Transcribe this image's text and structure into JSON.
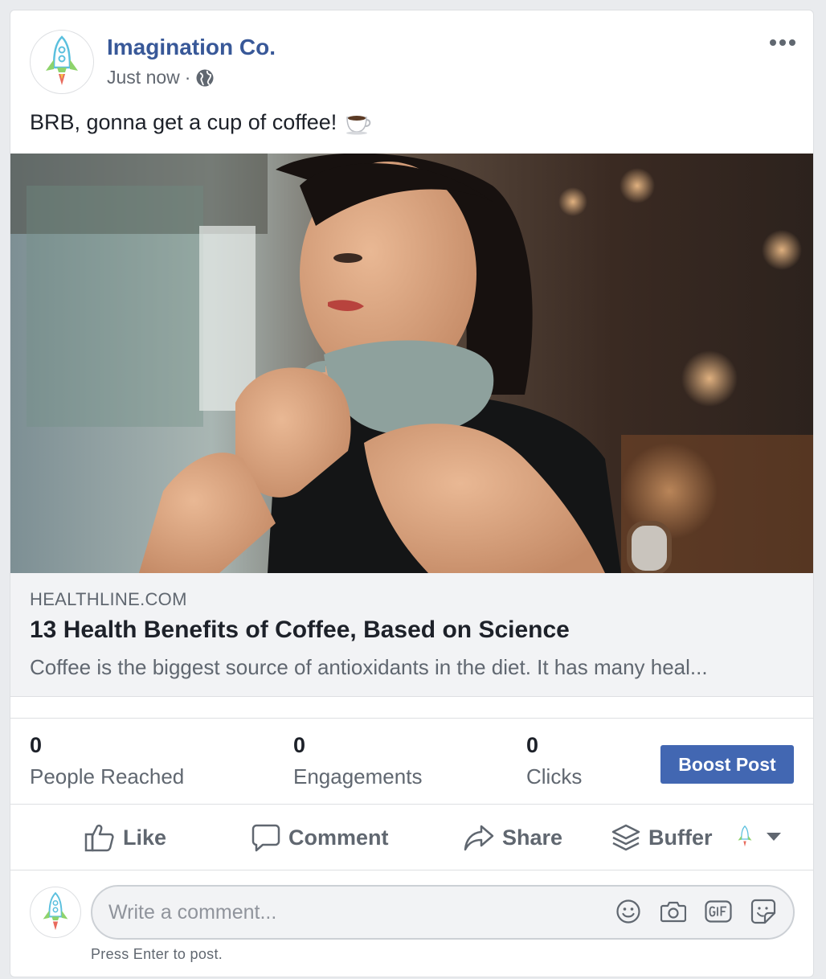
{
  "post": {
    "page_name": "Imagination Co.",
    "timestamp": "Just now",
    "separator": "·",
    "privacy_icon": "globe-icon",
    "more_icon": "more-horizontal-icon",
    "text": "BRB, gonna get a cup of coffee!",
    "text_emoji": "coffee-cup-emoji"
  },
  "link_preview": {
    "image": "woman-holding-coffee-cup-photo",
    "domain": "HEALTHLINE.COM",
    "title": "13 Health Benefits of Coffee, Based on Science",
    "description": "Coffee is the biggest source of antioxidants in the diet. It has many heal..."
  },
  "stats": {
    "people_reached": {
      "value": "0",
      "label": "People Reached"
    },
    "engagements": {
      "value": "0",
      "label": "Engagements"
    },
    "clicks": {
      "value": "0",
      "label": "Clicks"
    },
    "boost_label": "Boost Post"
  },
  "actions": {
    "like": "Like",
    "comment": "Comment",
    "share": "Share",
    "buffer": "Buffer"
  },
  "comment": {
    "placeholder": "Write a comment...",
    "hint": "Press Enter to post."
  },
  "colors": {
    "link": "#385898",
    "boost_bg": "#4267b2",
    "muted": "#606770",
    "preview_bg": "#f2f3f5"
  }
}
